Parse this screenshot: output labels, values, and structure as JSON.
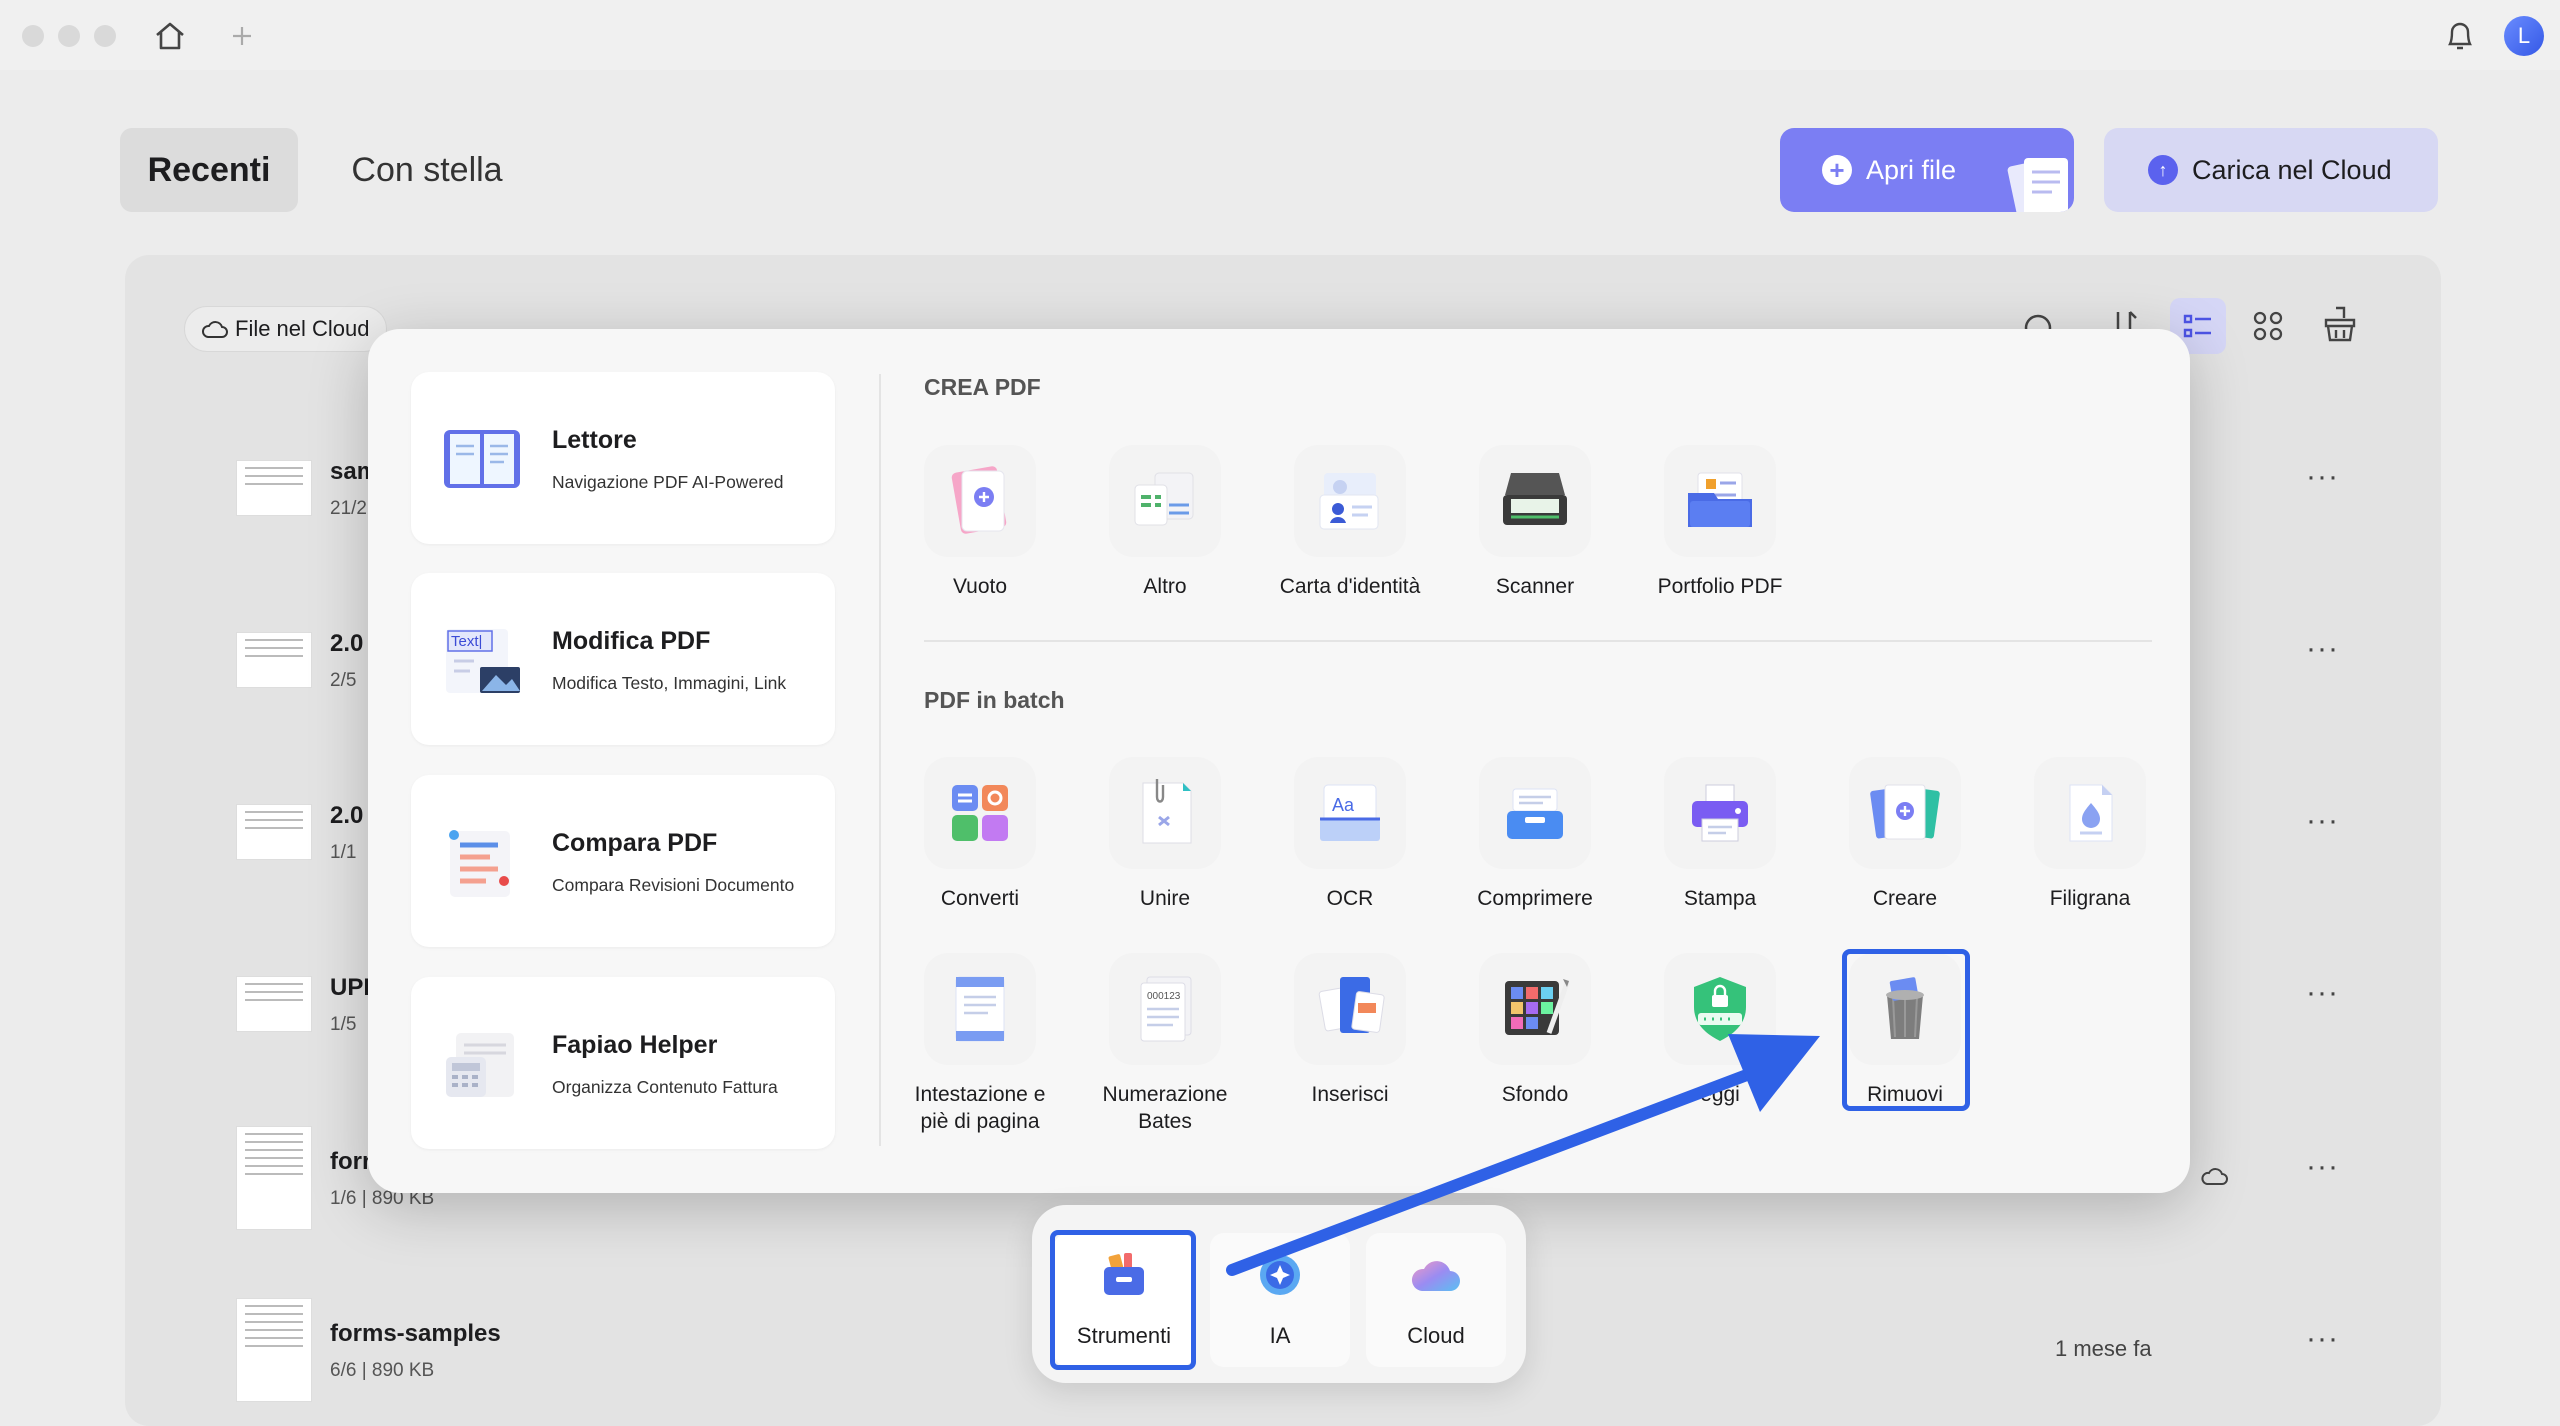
{
  "tabs": {
    "recent": "Recenti",
    "starred": "Con stella"
  },
  "buttons": {
    "open_file": "Apri file",
    "upload_cloud": "Carica nel Cloud",
    "files_in_cloud": "File nel Cloud"
  },
  "avatar": {
    "initial": "L"
  },
  "files": [
    {
      "name": "sam",
      "meta": "21/2"
    },
    {
      "name": "2.0",
      "meta": "2/5"
    },
    {
      "name": "2.0",
      "meta": "1/1"
    },
    {
      "name": "UPD",
      "meta": "1/5"
    },
    {
      "name": "forn",
      "meta": "1/6 | 890 KB"
    },
    {
      "name": "forms-samples",
      "meta": "6/6 | 890 KB",
      "date": "1 mese fa"
    }
  ],
  "cards": [
    {
      "title": "Lettore",
      "subtitle": "Navigazione PDF AI-Powered"
    },
    {
      "title": "Modifica PDF",
      "subtitle": "Modifica Testo, Immagini, Link"
    },
    {
      "title": "Compara PDF",
      "subtitle": "Compara Revisioni Documento"
    },
    {
      "title": "Fapiao Helper",
      "subtitle": "Organizza Contenuto Fattura"
    }
  ],
  "sections": {
    "create": "CREA PDF",
    "batch": "PDF in batch"
  },
  "create_tools": [
    "Vuoto",
    "Altro",
    "Carta d'identità",
    "Scanner",
    "Portfolio PDF"
  ],
  "batch_tools": [
    "Converti",
    "Unire",
    "OCR",
    "Comprimere",
    "Stampa",
    "Creare",
    "Filigrana"
  ],
  "batch_tools_row2": [
    "Intestazione e piè di pagina",
    "Numerazione Bates",
    "Inserisci",
    "Sfondo",
    "eggi",
    "Rimuovi"
  ],
  "icon_text": {
    "modify": "Text|",
    "ocr": "Aa",
    "bates": "000123"
  },
  "dock": [
    "Strumenti",
    "IA",
    "Cloud"
  ],
  "colors": {
    "accent": "#7b7ef3",
    "highlight": "#2f61e6",
    "arrow": "#2f61e6"
  }
}
